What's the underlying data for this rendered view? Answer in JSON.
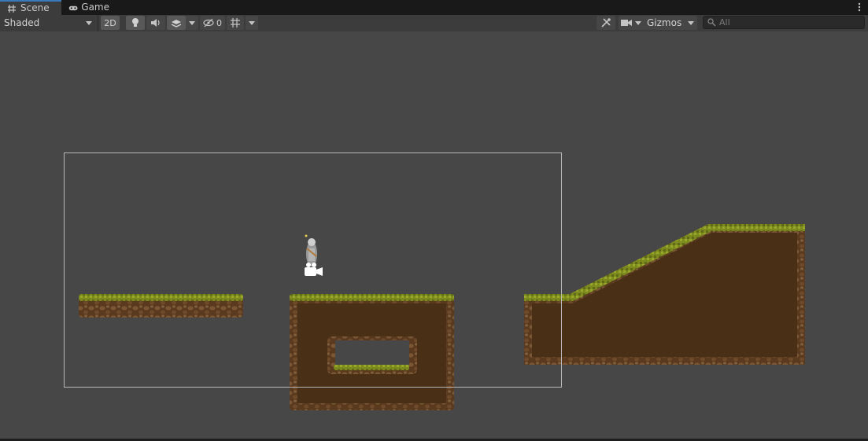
{
  "tabs": [
    {
      "label": "Scene",
      "icon": "grid-icon",
      "active": true
    },
    {
      "label": "Game",
      "icon": "gamepad-icon",
      "active": false
    }
  ],
  "toolbar": {
    "shading_mode": "Shaded",
    "mode_2d_label": "2D",
    "hidden_count": "0",
    "gizmos_label": "Gizmos",
    "search_placeholder": "All"
  },
  "colors": {
    "tab_accent": "#3a79bb",
    "viewport_bg": "#474747",
    "grass": "#7c8a1e",
    "dirt": "#4a2f17",
    "rock": "#6e4a2a"
  }
}
